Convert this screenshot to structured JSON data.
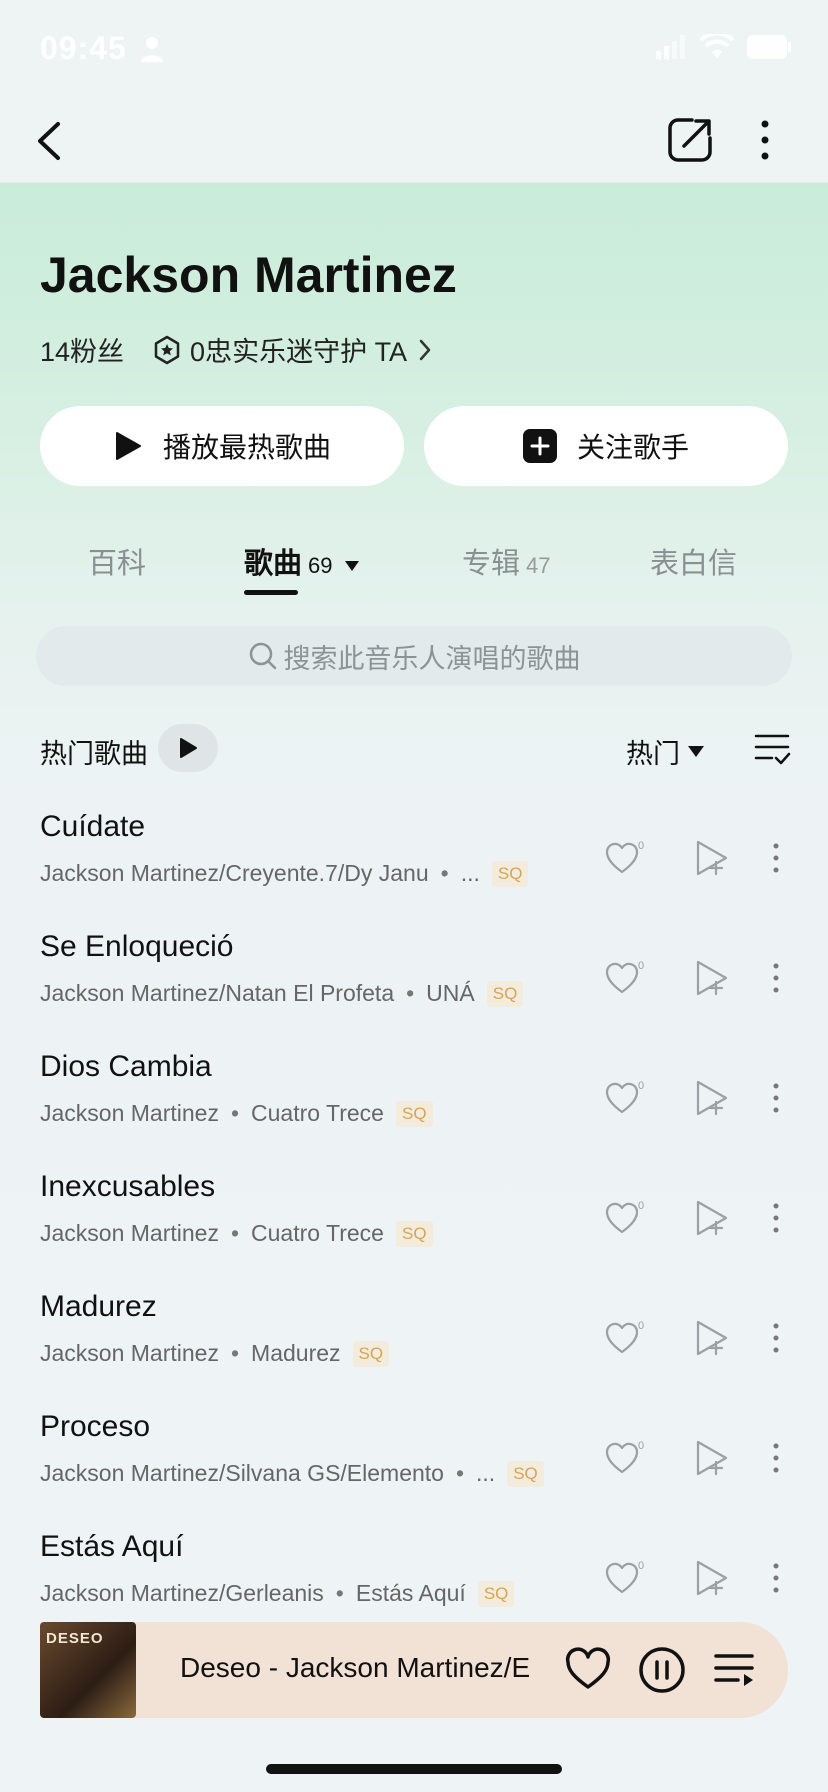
{
  "status_bar": {
    "time": "09:45"
  },
  "artist": {
    "name": "Jackson Martinez",
    "fans": "14粉丝",
    "guardians": "0忠实乐迷守护 TA"
  },
  "actions": {
    "play_hot": "播放最热歌曲",
    "follow": "关注歌手"
  },
  "tabs": [
    {
      "label": "百科",
      "count": ""
    },
    {
      "label": "歌曲",
      "count": "69"
    },
    {
      "label": "专辑",
      "count": "47"
    },
    {
      "label": "表白信",
      "count": ""
    }
  ],
  "search": {
    "placeholder": "搜索此音乐人演唱的歌曲"
  },
  "list_header": {
    "title": "热门歌曲",
    "sort": "热门"
  },
  "songs": [
    {
      "title": "Cuídate",
      "artists": "Jackson Martinez/Creyente.7/Dy Janu",
      "album": "...",
      "quality": "SQ"
    },
    {
      "title": "Se Enloqueció",
      "artists": "Jackson Martinez/Natan El Profeta",
      "album": "UNÁ",
      "quality": "SQ"
    },
    {
      "title": "Dios Cambia",
      "artists": "Jackson Martinez",
      "album": "Cuatro Trece",
      "quality": "SQ"
    },
    {
      "title": "Inexcusables",
      "artists": "Jackson Martinez",
      "album": "Cuatro Trece",
      "quality": "SQ"
    },
    {
      "title": "Madurez",
      "artists": "Jackson Martinez",
      "album": "Madurez",
      "quality": "SQ"
    },
    {
      "title": "Proceso",
      "artists": "Jackson Martinez/Silvana GS/Elemento",
      "album": "...",
      "quality": "SQ"
    },
    {
      "title": "Estás Aquí",
      "artists": "Jackson Martinez/Gerleanis",
      "album": "Estás Aquí",
      "quality": "SQ"
    }
  ],
  "like_count": "0",
  "dot_separator": "•",
  "now_playing": {
    "title": "Deseo - Jackson Martinez/E",
    "cover_text": "DESEO"
  },
  "icons": [
    "back-icon",
    "share-icon",
    "more-icon",
    "play-icon",
    "plus-icon",
    "search-icon",
    "heart-icon",
    "add-to-playlist-icon",
    "pause-icon",
    "playlist-icon"
  ]
}
